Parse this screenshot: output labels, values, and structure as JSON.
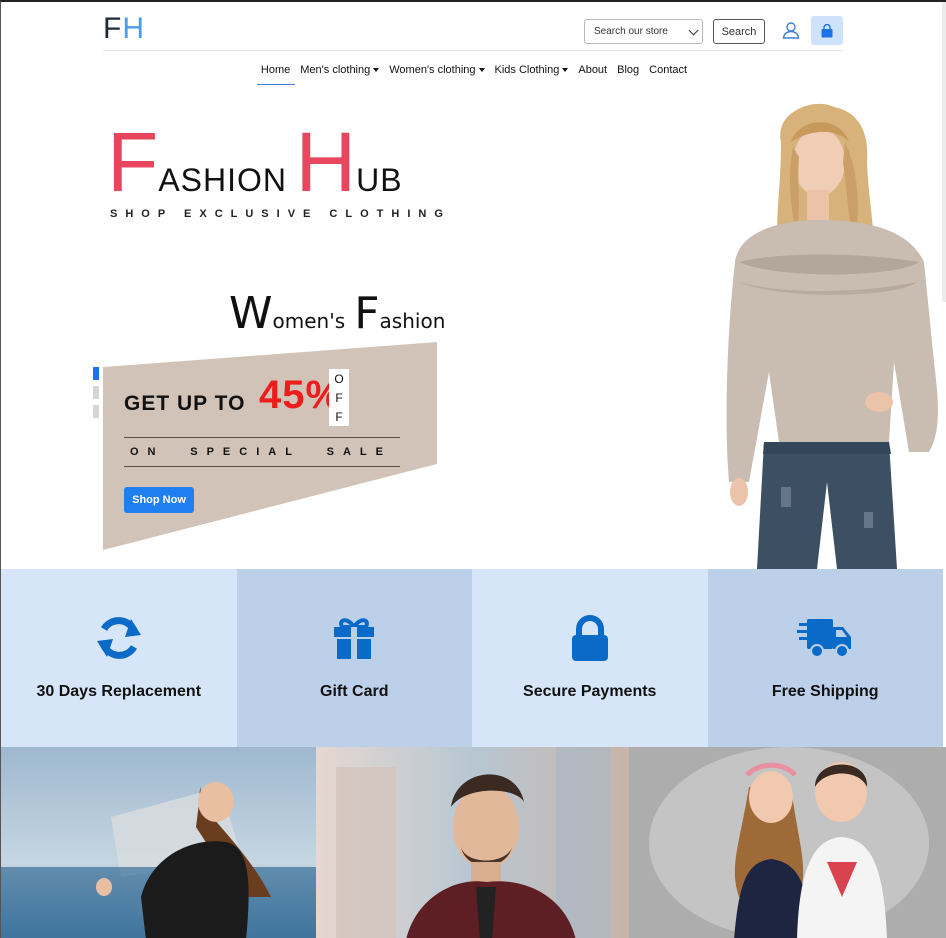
{
  "header": {
    "logo": {
      "first": "F",
      "second": "H"
    },
    "search_select": "Search our store",
    "search_button": "Search"
  },
  "nav": {
    "items": [
      {
        "label": "Home",
        "dropdown": false
      },
      {
        "label": "Men's clothing",
        "dropdown": true
      },
      {
        "label": "Women's clothing",
        "dropdown": true
      },
      {
        "label": "Kids Clothing",
        "dropdown": true
      },
      {
        "label": "About",
        "dropdown": false
      },
      {
        "label": "Blog",
        "dropdown": false
      },
      {
        "label": "Contact",
        "dropdown": false
      }
    ]
  },
  "hero": {
    "brand": {
      "f_cap": "F",
      "f_rest": "ASHION",
      "h_cap": "H",
      "h_rest": "UB"
    },
    "tagline": "SHOP EXCLUSIVE CLOTHING",
    "section": {
      "w_cap": "W",
      "w_rest": "omen's",
      "f_cap": "F",
      "f_rest": "ashion"
    },
    "promo": {
      "get_up_to": "GET UP TO",
      "percent": "45%",
      "off_letters": [
        "O",
        "F",
        "F"
      ],
      "sale_words": [
        "ON",
        "SPECIAL",
        "SALE"
      ],
      "button": "Shop Now"
    },
    "slides": 3,
    "active_slide": 0
  },
  "features": [
    {
      "label": "30 Days Replacement",
      "icon": "refresh-icon"
    },
    {
      "label": "Gift Card",
      "icon": "gift-icon"
    },
    {
      "label": "Secure Payments",
      "icon": "lock-icon"
    },
    {
      "label": "Free Shipping",
      "icon": "truck-icon"
    }
  ],
  "colors": {
    "accent": "#1f7ef0",
    "brand_pink": "#e8455e",
    "promo_bg": "#d2c3b8",
    "feature_light": "#d6e6f8",
    "feature_dark": "#bcd0ea",
    "icon_blue": "#0a6ac8"
  }
}
